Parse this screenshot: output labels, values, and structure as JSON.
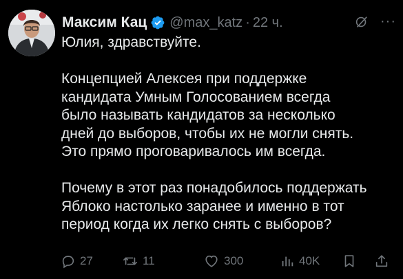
{
  "tweet": {
    "author_name": "Максим Кац",
    "handle": "@max_katz",
    "separator": "·",
    "time": "22 ч.",
    "more": "···",
    "paragraphs": [
      [
        "Юлия, здравствуйте."
      ],
      [
        "Концепцией Алексея при поддержке",
        "кандидата Умным Голосованием всегда",
        "было называть кандидатов за несколько",
        "дней до выборов, чтобы их не могли снять.",
        "Это прямо проговаривалось им всегда."
      ],
      [
        "Почему в этот раз понадобилось поддержать",
        "Яблоко настолько заранее и именно в тот",
        "период когда их легко снять с выборов?"
      ]
    ]
  },
  "actions": {
    "replies": "27",
    "retweets": "11",
    "likes": "300",
    "views": "40K"
  },
  "colors": {
    "background": "#000000",
    "text": "#e7e9ea",
    "muted": "#71767b",
    "verified": "#1d9bf0"
  },
  "icons": {
    "verified": "verified-badge-icon",
    "grok": "grok-icon",
    "more": "more-icon",
    "reply": "reply-icon",
    "retweet": "retweet-icon",
    "like": "heart-icon",
    "views": "views-icon",
    "bookmark": "bookmark-icon",
    "share": "share-icon"
  }
}
